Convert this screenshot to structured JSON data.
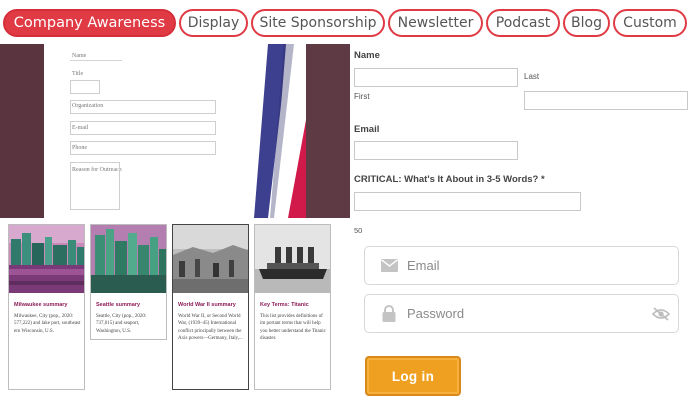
{
  "tabs": [
    {
      "label": "Company Awareness",
      "active": true
    },
    {
      "label": "Display",
      "active": false
    },
    {
      "label": "Site Sponsorship",
      "active": false
    },
    {
      "label": "Newsletter",
      "active": false
    },
    {
      "label": "Podcast",
      "active": false
    },
    {
      "label": "Blog",
      "active": false
    },
    {
      "label": "Custom",
      "active": false
    }
  ],
  "mock_form": {
    "name_label": "Name",
    "title_label": "Title",
    "organization_label": "Organization",
    "email_label": "E-mail",
    "phone_label": "Phone",
    "reason_label": "Reason for Outreach"
  },
  "cards": [
    {
      "title": "Milwaukee summary",
      "body": "Milwaukee, City (pop., 2020: 577,222) and lake port, southeast ern Wisconsin, U.S."
    },
    {
      "title": "Seattle summary",
      "body": "Seattle, City (pop., 2020: 737,015) and seaport, Washington, U.S."
    },
    {
      "title": "World War II summary",
      "body": "World War II, or Second World War, (1939–45) International conflict principally between the Axis powers—Germany, Italy,..."
    },
    {
      "title": "Key Terms: Titanic",
      "body": "This list provides definitions of im portant terms that will help you better understand the Titanic disaster."
    }
  ],
  "right_form": {
    "name_label": "Name",
    "first_sublabel": "First",
    "last_sublabel": "Last",
    "email_label": "Email",
    "critical_label": "CRITICAL: What's It About in 3-5 Words? *",
    "char_count": "50"
  },
  "login": {
    "email_placeholder": "Email",
    "password_placeholder": "Password",
    "button_label": "Log in"
  },
  "colors": {
    "accent_red": "#e03a44",
    "maroon": "#5a3540",
    "button_orange": "#f0a020",
    "card_title": "#8a1b56"
  }
}
